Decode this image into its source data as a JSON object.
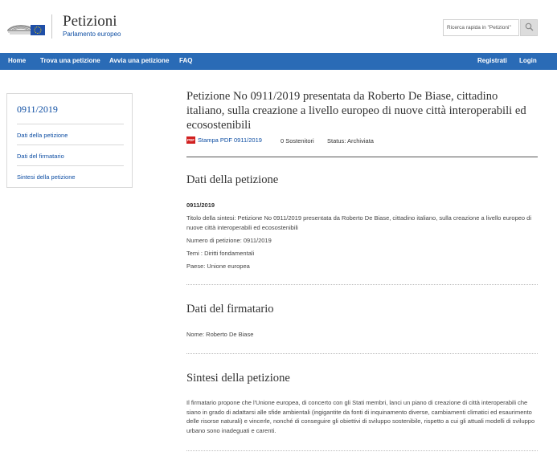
{
  "header": {
    "title": "Petizioni",
    "subtitle": "Parlamento europeo",
    "search_placeholder": "Ricerca rapida in \"Petizioni\""
  },
  "nav": {
    "left": [
      "Home",
      "Trova una petizione",
      "Avvia una petizione",
      "FAQ"
    ],
    "right": [
      "Registrati",
      "Login"
    ]
  },
  "sidebar": {
    "title": "0911/2019",
    "items": [
      "Dati della petizione",
      "Dati del firmatario",
      "Sintesi della petizione"
    ]
  },
  "petition": {
    "title": "Petizione No 0911/2019 presentata da Roberto De Biase, cittadino italiano, sulla creazione a livello europeo di nuove città interoperabili ed ecosostenibili",
    "pdf_badge": "PDF",
    "pdf_link": "Stampa PDF 0911/2019",
    "supporters": "0 Sostenitori",
    "status": "Status: Archiviata"
  },
  "dati": {
    "heading": "Dati della petizione",
    "number": "0911/2019",
    "summary_title": "Titolo della sintesi: Petizione No 0911/2019 presentata da Roberto De Biase, cittadino italiano, sulla creazione a livello europeo di nuove città interoperabili ed ecosostenibili",
    "petition_number": "Numero di petizione: 0911/2019",
    "topics": "Temi : Diritti fondamentali",
    "country": "Paese: Unione europea"
  },
  "firmatario": {
    "heading": "Dati del firmatario",
    "name": "Nome: Roberto De Biase"
  },
  "sintesi": {
    "heading": "Sintesi della petizione",
    "text": "Il firmatario propone che l'Unione europea, di concerto con gli Stati membri, lanci un piano di creazione di città interoperabili che siano in grado di adattarsi alle sfide ambientali (ingigantite da fonti di inquinamento diverse, cambiamenti climatici ed esaurimento delle risorse naturali) e vincerle, nonché di conseguire gli obiettivi di sviluppo sostenibile, rispetto a cui gli attuali modelli di sviluppo urbano sono inadeguati e carenti."
  }
}
